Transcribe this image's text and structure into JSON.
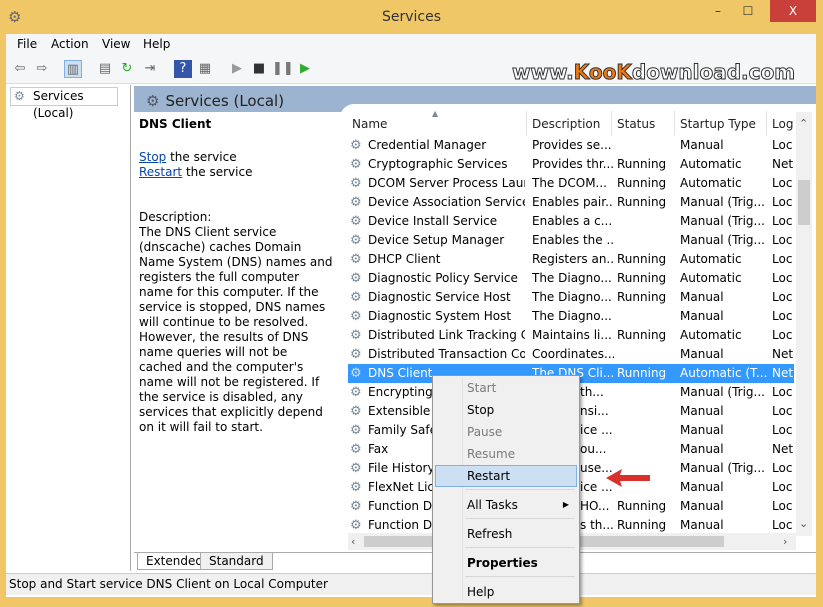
{
  "window": {
    "title": "Services",
    "minimize": "–",
    "maximize": "☐",
    "close": "X"
  },
  "menubar": [
    "File",
    "Action",
    "View",
    "Help"
  ],
  "watermark": {
    "a": "www.",
    "b": "KooK",
    "c": "download.com"
  },
  "tree": {
    "item": "Services (Local)"
  },
  "header": {
    "title": "Services (Local)"
  },
  "detail": {
    "name": "DNS Client",
    "stop_link": "Stop",
    "stop_rest": " the service",
    "restart_link": "Restart",
    "restart_rest": " the service",
    "desc_label": "Description:",
    "desc": "The DNS Client service (dnscache) caches Domain Name System (DNS) names and registers the full computer name for this computer. If the service is stopped, DNS names will continue to be resolved. However, the results of DNS name queries will not be cached and the computer's name will not be registered. If the service is disabled, any services that explicitly depend on it will fail to start."
  },
  "columns": [
    "Name",
    "Description",
    "Status",
    "Startup Type",
    "Log"
  ],
  "rows": [
    [
      "Credential Manager",
      "Provides se...",
      "",
      "Manual",
      "Loc"
    ],
    [
      "Cryptographic Services",
      "Provides thr...",
      "Running",
      "Automatic",
      "Net"
    ],
    [
      "DCOM Server Process Laun...",
      "The DCOM...",
      "Running",
      "Automatic",
      "Loc"
    ],
    [
      "Device Association Service",
      "Enables pair...",
      "Running",
      "Manual (Trig...",
      "Loc"
    ],
    [
      "Device Install Service",
      "Enables a c...",
      "",
      "Manual (Trig...",
      "Loc"
    ],
    [
      "Device Setup Manager",
      "Enables the ...",
      "",
      "Manual (Trig...",
      "Loc"
    ],
    [
      "DHCP Client",
      "Registers an...",
      "Running",
      "Automatic",
      "Loc"
    ],
    [
      "Diagnostic Policy Service",
      "The Diagno...",
      "Running",
      "Automatic",
      "Loc"
    ],
    [
      "Diagnostic Service Host",
      "The Diagno...",
      "Running",
      "Manual",
      "Loc"
    ],
    [
      "Diagnostic System Host",
      "The Diagno...",
      "",
      "Manual",
      "Loc"
    ],
    [
      "Distributed Link Tracking Cl...",
      "Maintains li...",
      "Running",
      "Automatic",
      "Loc"
    ],
    [
      "Distributed Transaction Co...",
      "Coordinates...",
      "",
      "Manual",
      "Net"
    ],
    [
      "DNS Client",
      "The DNS Cli...",
      "Running",
      "Automatic (T...",
      "Net"
    ],
    [
      "Encrypting F",
      "th...",
      "",
      "Manual (Trig...",
      "Loc"
    ],
    [
      "Extensible A",
      "nsi...",
      "",
      "Manual",
      "Loc"
    ],
    [
      "Family Safet",
      "ice ...",
      "",
      "Manual",
      "Loc"
    ],
    [
      "Fax",
      "ou...",
      "",
      "Manual",
      "Net"
    ],
    [
      "File History S",
      "use...",
      "",
      "Manual (Trig...",
      "Loc"
    ],
    [
      "FlexNet Lice",
      "ice ...",
      "",
      "Manual",
      "Loc"
    ],
    [
      "Function Dis",
      "HO...",
      "Running",
      "Manual",
      "Loc"
    ],
    [
      "Function Dis",
      "s th...",
      "Running",
      "Manual",
      "Loc"
    ]
  ],
  "selected_row": 12,
  "tabs": [
    "Extended",
    "Standard"
  ],
  "status": "Stop and Start service DNS Client on Local Computer",
  "context_menu": [
    {
      "label": "Start",
      "disabled": true
    },
    {
      "label": "Stop"
    },
    {
      "label": "Pause",
      "disabled": true
    },
    {
      "label": "Resume",
      "disabled": true
    },
    {
      "label": "Restart",
      "hover": true
    },
    {
      "label": "All Tasks",
      "submenu": true
    },
    {
      "label": "Refresh"
    },
    {
      "label": "Properties",
      "bold": true
    },
    {
      "label": "Help"
    }
  ],
  "colors": {
    "titlebar": "#efc766",
    "close": "#c9403b",
    "selection": "#3399ff",
    "header_band": "#9cb4cf",
    "annotation_arrow": "#d9302a"
  }
}
